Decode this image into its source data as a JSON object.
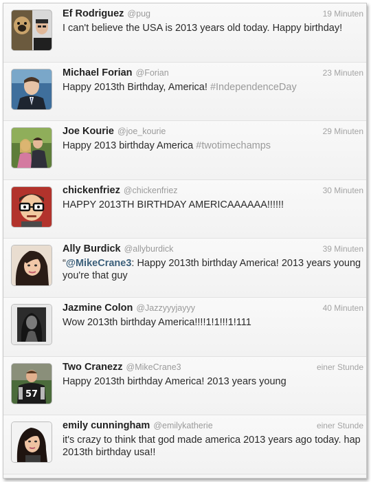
{
  "tweets": [
    {
      "name": "Ef Rodriguez",
      "handle": "@pug",
      "time": "19 Minuten",
      "lines": [
        "I can't believe the USA is 2013 years old today. Happy birthday!"
      ],
      "avatar": "pug-and-man-avatar"
    },
    {
      "name": "Michael Forian",
      "handle": "@Forian",
      "time": "23 Minuten",
      "text": "Happy 2013th Birthday, America!",
      "hashtag": "#IndependenceDay",
      "avatar": "man-in-suit-avatar"
    },
    {
      "name": "Joe Kourie",
      "handle": "@joe_kourie",
      "time": "29 Minuten",
      "text": "Happy 2013 birthday America",
      "hashtag": "#twotimechamps",
      "avatar": "couple-photo-avatar"
    },
    {
      "name": "chickenfriez",
      "handle": "@chickenfriez",
      "time": "30 Minuten",
      "lines": [
        "HAPPY 2013TH BIRTHDAY AMERICAAAAAA!!!!!!"
      ],
      "avatar": "cartoon-glasses-avatar"
    },
    {
      "name": "Ally Burdick",
      "handle": "@allyburdick",
      "time": "39 Minuten",
      "quote_open": "“",
      "mention": "@MikeCrane3",
      "text": ": Happy 2013th birthday America! 2013 years young",
      "line2": "you're that guy",
      "avatar": "girl-selfie-avatar"
    },
    {
      "name": "Jazmine Colon",
      "handle": "@Jazzyyyjayyy",
      "time": "40 Minuten",
      "lines": [
        "Wow 2013th birthday America!!!!1!1!!!1!111"
      ],
      "avatar": "dark-portrait-avatar"
    },
    {
      "name": "Two Cranezz",
      "handle": "@MikeCrane3",
      "time": "einer Stunde",
      "lines": [
        "Happy 2013th birthday America! 2013 years young"
      ],
      "avatar": "football-player-avatar"
    },
    {
      "name": "emily cunningham",
      "handle": "@emilykatherie",
      "time": "einer Stunde",
      "lines": [
        "it's crazy to think that god made america 2013 years ago today. hap",
        "2013th birthday usa!!"
      ],
      "avatar": "girl-portrait-avatar"
    }
  ]
}
